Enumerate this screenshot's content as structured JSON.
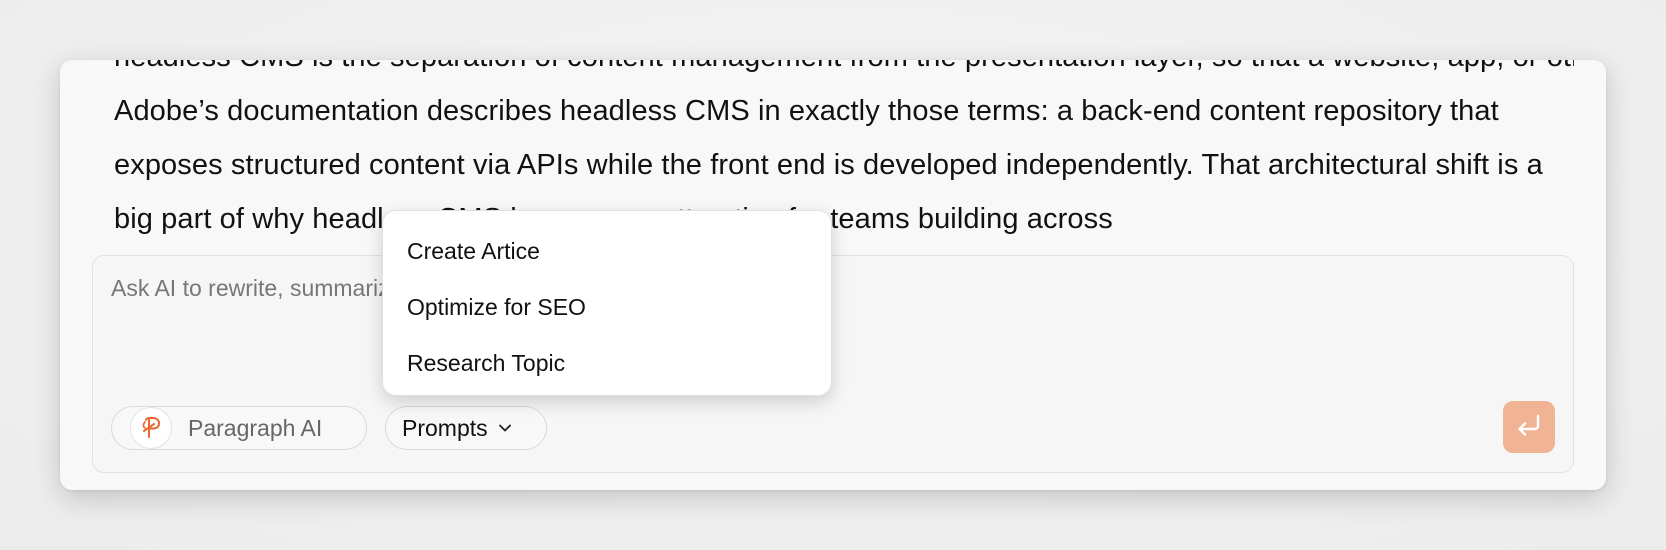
{
  "document": {
    "partial_line": "headless CMS is the separation of content management from the presentation layer, so that a website, app, or other",
    "paragraph": "Adobe’s documentation describes headless CMS in exactly those terms: a back-end content repository that exposes structured content via APIs while the front end is developed independently. That architectural shift is a big part of why headless CMS became so attractive for teams building across"
  },
  "composer": {
    "placeholder": "Ask AI to rewrite, summarize, or expand the selected text…",
    "paragraph_ai_label": "Paragraph AI",
    "paragraph_ai_logo_glyph": "Ᵽ",
    "prompts_label": "Prompts",
    "send_icon": "return-arrow-icon"
  },
  "prompts_menu": {
    "items": [
      {
        "label": "Create Artice"
      },
      {
        "label": "Optimize for SEO"
      },
      {
        "label": "Research Topic"
      }
    ]
  },
  "colors": {
    "accent": "#e8672e",
    "send_button": "#f0b394",
    "card_background": "#f8f8f8"
  }
}
